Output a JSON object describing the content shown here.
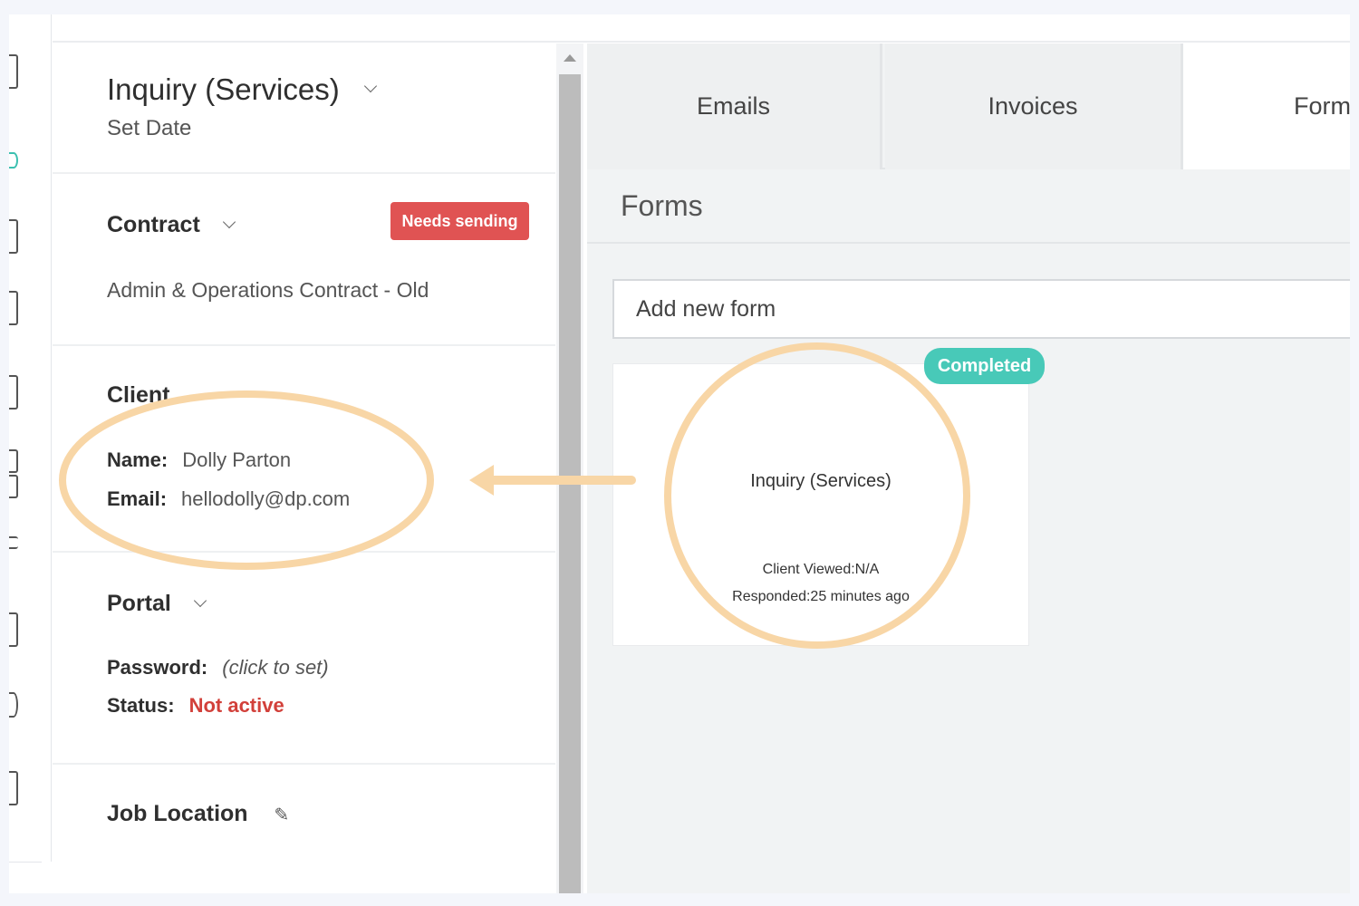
{
  "inquiry": {
    "title": "Inquiry (Services)",
    "subtitle": "Set Date"
  },
  "contract": {
    "title": "Contract",
    "badge": "Needs sending",
    "name": "Admin & Operations Contract - Old"
  },
  "client": {
    "title": "Client",
    "name_label": "Name:",
    "name_value": "Dolly Parton",
    "email_label": "Email:",
    "email_value": "hellodolly@dp.com"
  },
  "portal": {
    "title": "Portal",
    "password_label": "Password:",
    "password_value": "(click to set)",
    "status_label": "Status:",
    "status_value": "Not active"
  },
  "job_location": {
    "title": "Job Location"
  },
  "tabs": [
    {
      "label": "Emails"
    },
    {
      "label": "Invoices"
    },
    {
      "label": "Form"
    }
  ],
  "forms": {
    "title": "Forms",
    "add_button": "Add new form",
    "card": {
      "title": "Inquiry (Services)",
      "badge": "Completed",
      "client_viewed": "Client Viewed:N/A",
      "responded": "Responded:25 minutes ago"
    }
  },
  "colors": {
    "needs_sending": "#e05353",
    "completed": "#48c9b8",
    "not_active": "#d2403a",
    "annotation": "#f8d6a6"
  }
}
